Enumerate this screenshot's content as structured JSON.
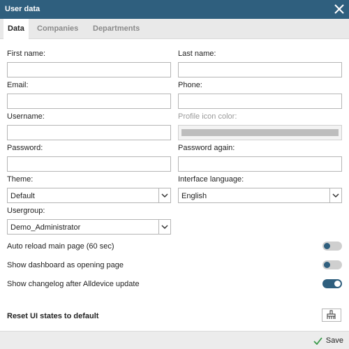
{
  "window": {
    "title": "User data"
  },
  "tabs": [
    {
      "label": "Data",
      "active": true
    },
    {
      "label": "Companies",
      "active": false
    },
    {
      "label": "Departments",
      "active": false
    }
  ],
  "form": {
    "first_name": {
      "label": "First name:",
      "value": ""
    },
    "last_name": {
      "label": "Last name:",
      "value": ""
    },
    "email": {
      "label": "Email:",
      "value": ""
    },
    "phone": {
      "label": "Phone:",
      "value": ""
    },
    "username": {
      "label": "Username:",
      "value": ""
    },
    "profile_icon_color": {
      "label": "Profile icon color:"
    },
    "password": {
      "label": "Password:",
      "value": ""
    },
    "password_again": {
      "label": "Password again:",
      "value": ""
    },
    "theme": {
      "label": "Theme:",
      "value": "Default"
    },
    "interface_language": {
      "label": "Interface language:",
      "value": "English"
    },
    "usergroup": {
      "label": "Usergroup:",
      "value": "Demo_Administrator"
    }
  },
  "toggles": [
    {
      "label": "Auto reload main page (60 sec)",
      "on": false
    },
    {
      "label": "Show dashboard as opening page",
      "on": false
    },
    {
      "label": "Show changelog after Alldevice update",
      "on": true
    }
  ],
  "reset": {
    "label": "Reset UI states to default",
    "icon": "broom-icon"
  },
  "footer": {
    "save_label": "Save",
    "icon": "checkmark-icon"
  },
  "colors": {
    "accent": "#2f5f7e",
    "save_check": "#3a9a4a"
  }
}
